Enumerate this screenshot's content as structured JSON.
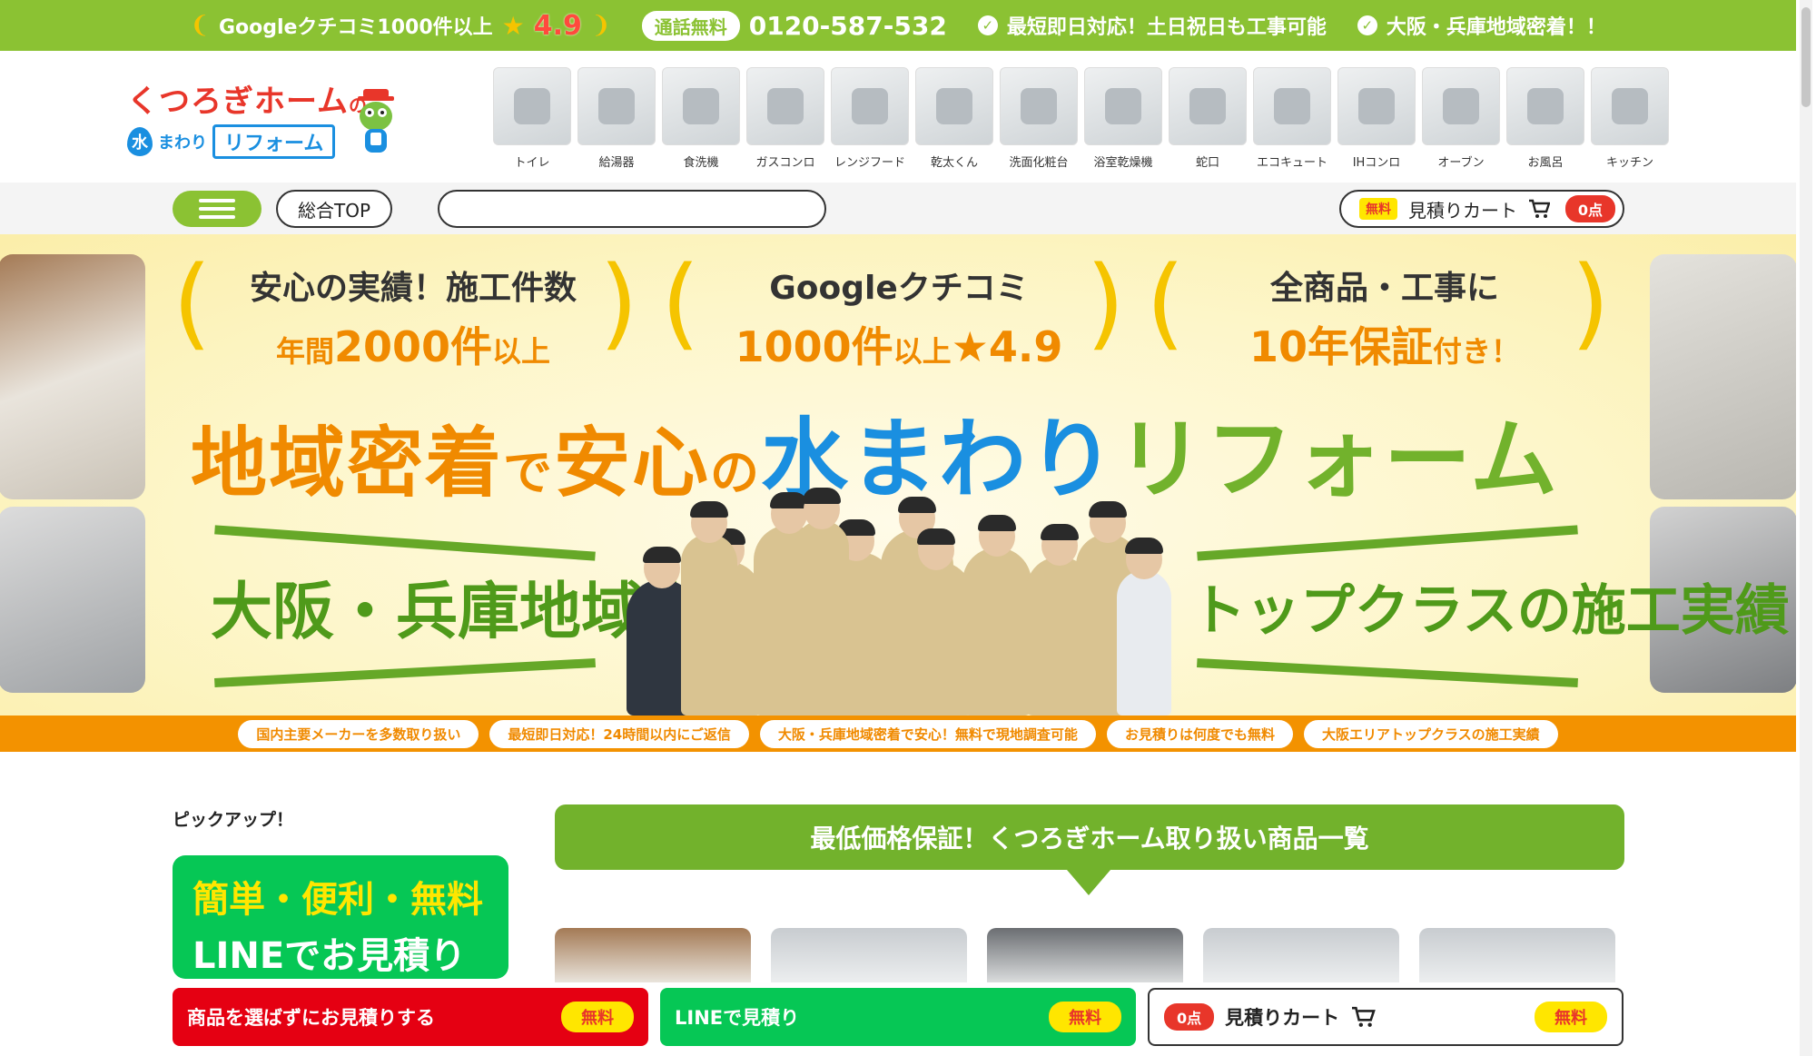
{
  "topbar": {
    "google_text": "Googleクチコミ1000件以上",
    "rating": "4.9",
    "free_call": "通話無料",
    "phone": "0120-587-532",
    "point1": "最短即日対応！土日祝日も工事可能",
    "point2": "大阪・兵庫地域密着！！"
  },
  "logo": {
    "line1": "くつろぎホーム",
    "line1_suffix": "の",
    "mawari": "まわり",
    "reform": "リフォーム",
    "drop_char": "水"
  },
  "products": [
    {
      "label": "トイレ",
      "icon": "toilet-icon"
    },
    {
      "label": "給湯器",
      "icon": "water-heater-icon"
    },
    {
      "label": "食洗機",
      "icon": "dishwasher-icon"
    },
    {
      "label": "ガスコンロ",
      "icon": "gas-stove-icon"
    },
    {
      "label": "レンジフード",
      "icon": "range-hood-icon"
    },
    {
      "label": "乾太くん",
      "icon": "dryer-icon"
    },
    {
      "label": "洗面化粧台",
      "icon": "vanity-icon"
    },
    {
      "label": "浴室乾燥機",
      "icon": "bath-dryer-icon"
    },
    {
      "label": "蛇口",
      "icon": "faucet-icon"
    },
    {
      "label": "エコキュート",
      "icon": "ecocute-icon"
    },
    {
      "label": "IHコンロ",
      "icon": "ih-stove-icon"
    },
    {
      "label": "オーブン",
      "icon": "oven-icon"
    },
    {
      "label": "お風呂",
      "icon": "bathtub-icon"
    },
    {
      "label": "キッチン",
      "icon": "kitchen-icon"
    }
  ],
  "nav": {
    "top_label": "総合TOP",
    "search_placeholder": "",
    "cart_free": "無料",
    "cart_label": "見積りカート",
    "cart_count": "0点"
  },
  "hero": {
    "stat1_a": "安心の実績！施工件数",
    "stat1_b_prefix": "年間",
    "stat1_b": "2000件",
    "stat1_b_suffix": "以上",
    "stat2_a": "Googleクチコミ",
    "stat2_b": "1000件",
    "stat2_b_mid": "以上",
    "stat2_b_rating": "★4.9",
    "stat3_a": "全商品・工事に",
    "stat3_b": "10年保証",
    "stat3_b_suffix": "付き！",
    "copy_1": "地域密着",
    "copy_de": "で",
    "copy_2": "安心",
    "copy_no": "の",
    "copy_blue": "水まわり",
    "copy_green": "リフォーム",
    "slogan_left": "大阪・兵庫地域密着!",
    "slogan_right": "トップクラスの施工実績"
  },
  "ribbon": [
    "国内主要メーカーを多数取り扱い",
    "最短即日対応！24時間以内にご返信",
    "大阪・兵庫地域密着で安心！無料で現地調査可能",
    "お見積りは何度でも無料",
    "大阪エリアトップクラスの施工実績"
  ],
  "content": {
    "pickup_title": "ピックアップ！",
    "line_card_1": "簡単・便利・無料",
    "line_card_2": "LINEでお見積り",
    "section_title": "最低価格保証！くつろぎホーム取り扱い商品一覧"
  },
  "footer": {
    "estimate_label": "商品を選ばずにお見積りする",
    "line_label": "LINEで見積り",
    "free": "無料",
    "cart_count": "0点",
    "cart_label": "見積りカート"
  },
  "colors": {
    "brand_green": "#8bc233",
    "accent_orange": "#f08a00",
    "alert_red": "#e50012",
    "line_green": "#06c755"
  }
}
